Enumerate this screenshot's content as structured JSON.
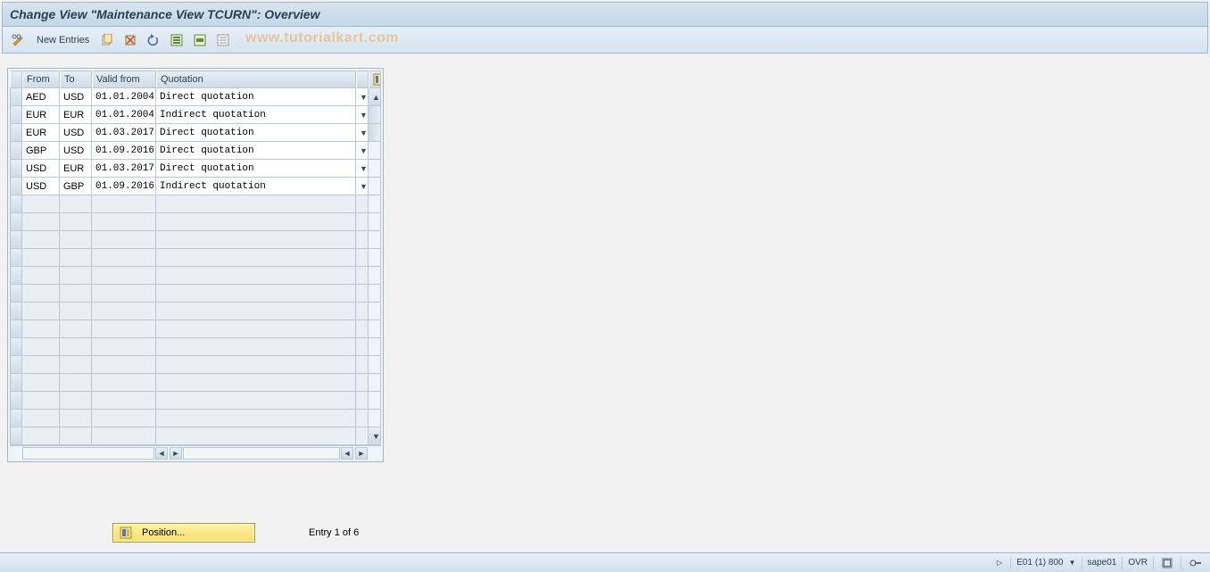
{
  "title": "Change View \"Maintenance View TCURN\": Overview",
  "toolbar": {
    "new_entries": "New Entries"
  },
  "watermark": "www.tutorialkart.com",
  "columns": {
    "from": "From",
    "to": "To",
    "valid_from": "Valid from",
    "quotation": "Quotation"
  },
  "rows": [
    {
      "from": "AED",
      "to": "USD",
      "valid": "01.01.2004",
      "quotation": "Direct quotation"
    },
    {
      "from": "EUR",
      "to": "EUR",
      "valid": "01.01.2004",
      "quotation": "Indirect quotation"
    },
    {
      "from": "EUR",
      "to": "USD",
      "valid": "01.03.2017",
      "quotation": "Direct quotation"
    },
    {
      "from": "GBP",
      "to": "USD",
      "valid": "01.09.2016",
      "quotation": "Direct quotation"
    },
    {
      "from": "USD",
      "to": "EUR",
      "valid": "01.03.2017",
      "quotation": "Direct quotation"
    },
    {
      "from": "USD",
      "to": "GBP",
      "valid": "01.09.2016",
      "quotation": "Indirect quotation"
    }
  ],
  "empty_row_count": 14,
  "position": {
    "label": "Position..."
  },
  "entry_text": "Entry 1 of 6",
  "status": {
    "server": "E01 (1) 800",
    "client": "sape01",
    "mode": "OVR"
  }
}
